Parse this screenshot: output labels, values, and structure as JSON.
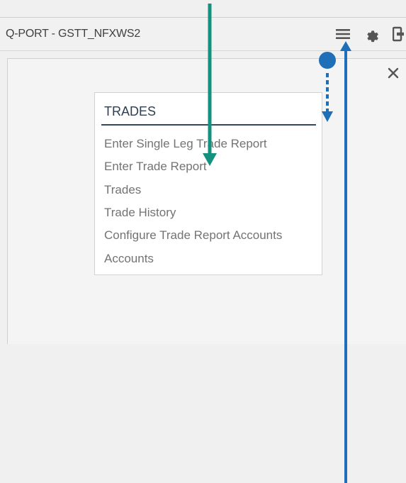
{
  "header": {
    "title": "Q-PORT - GSTT_NFXWS2",
    "icons": [
      "menu-icon",
      "gear-icon",
      "sign-out-icon"
    ]
  },
  "panel": {
    "close_icon": "close-icon"
  },
  "menu": {
    "heading": "TRADES",
    "items": [
      "Enter Single Leg Trade Report",
      "Enter Trade Report",
      "Trades",
      "Trade History",
      "Configure Trade Report Accounts",
      "Accounts"
    ]
  },
  "annotations": {
    "colors": {
      "green_arrow": "#15927f",
      "blue_arrow": "#1f6fb8"
    }
  }
}
